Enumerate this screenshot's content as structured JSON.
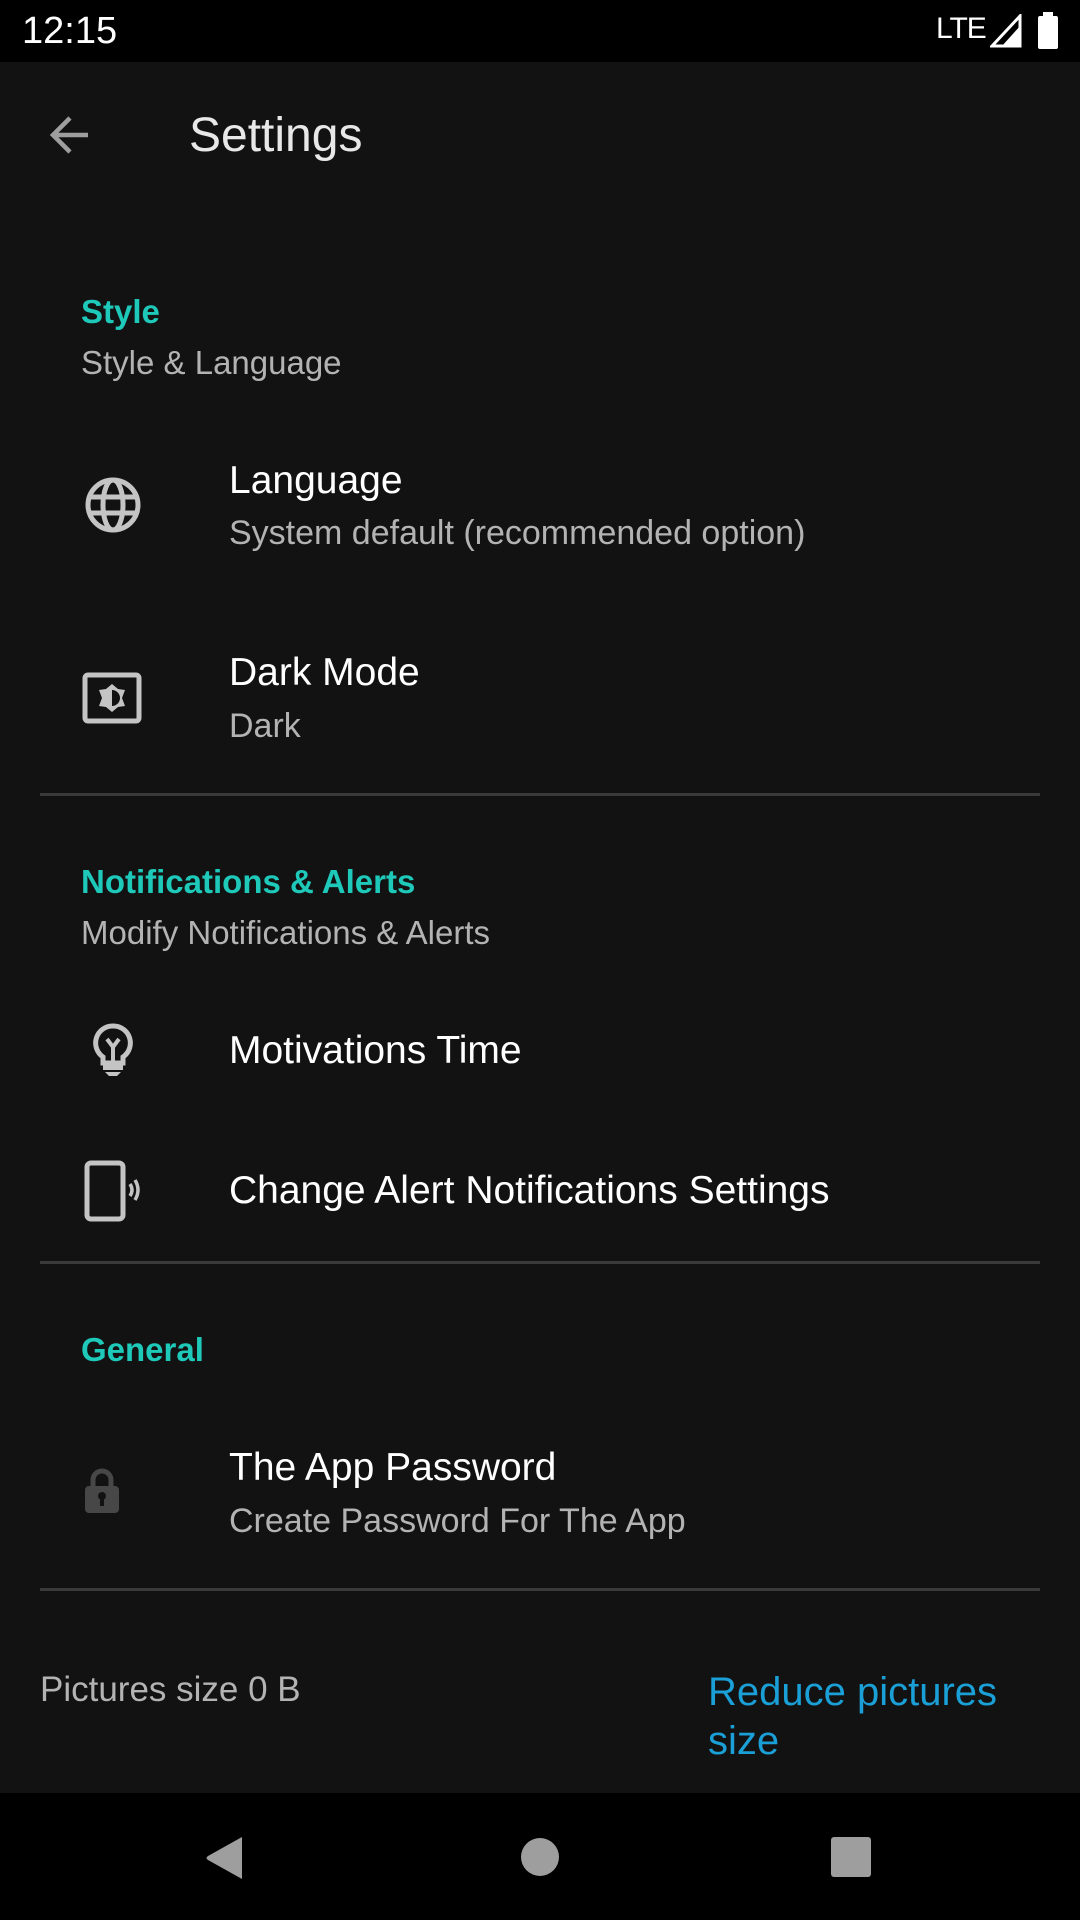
{
  "status_bar": {
    "time": "12:15",
    "network": "LTE",
    "icons": [
      "signal-icon",
      "battery-icon"
    ]
  },
  "toolbar": {
    "title": "Settings",
    "back_icon": "arrow-back-icon"
  },
  "sections": [
    {
      "header": "Style",
      "subtitle": "Style & Language",
      "items": [
        {
          "icon": "globe-icon",
          "title": "Language",
          "summary": "System default (recommended option)"
        },
        {
          "icon": "brightness-icon",
          "title": "Dark Mode",
          "summary": "Dark"
        }
      ]
    },
    {
      "header": "Notifications & Alerts",
      "subtitle": "Modify Notifications & Alerts",
      "items": [
        {
          "icon": "lightbulb-icon",
          "title": "Motivations Time"
        },
        {
          "icon": "phone-vibrate-icon",
          "title": "Change Alert Notifications Settings"
        }
      ]
    },
    {
      "header": "General",
      "items": [
        {
          "icon": "lock-icon",
          "title": "The App Password",
          "summary": "Create Password For The App"
        }
      ]
    }
  ],
  "footer": {
    "pictures_size": "Pictures size 0 B",
    "reduce_link": "Reduce pictures size"
  },
  "colors": {
    "accent": "#1ec9ba",
    "link": "#1a9fd6",
    "background": "#121212"
  },
  "nav_bar": {
    "buttons": [
      "back",
      "home",
      "recents"
    ]
  }
}
